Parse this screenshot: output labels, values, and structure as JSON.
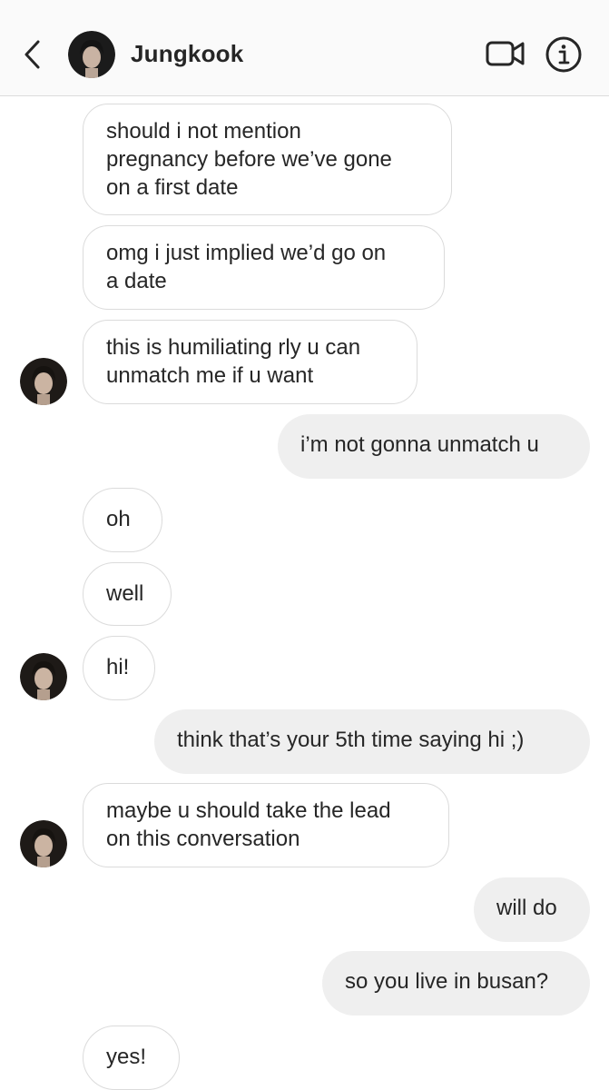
{
  "header": {
    "contact_name": "Jungkook",
    "icons": [
      "back-chevron-icon",
      "video-call-icon",
      "info-icon"
    ]
  },
  "messages": [
    {
      "side": "in",
      "text": "should i not mention\npregnancy before we’ve gone\non a first date"
    },
    {
      "side": "in",
      "text": "omg i just implied we’d go on\na date"
    },
    {
      "side": "in",
      "text": "this is humiliating rly u can\nunmatch me if u want"
    },
    {
      "side": "out",
      "text": "i’m not gonna unmatch u"
    },
    {
      "side": "in",
      "text": "oh"
    },
    {
      "side": "in",
      "text": "well"
    },
    {
      "side": "in",
      "text": "hi!"
    },
    {
      "side": "out",
      "text": "think that’s your 5th time saying hi ;)"
    },
    {
      "side": "in",
      "text": "maybe u should take the lead\non this conversation"
    },
    {
      "side": "out",
      "text": "will do"
    },
    {
      "side": "out",
      "text": "so you live in busan?"
    },
    {
      "side": "in",
      "text": "yes!"
    }
  ],
  "colors": {
    "incoming_bubble_bg": "#ffffff",
    "incoming_bubble_border": "#dbdbdb",
    "outgoing_bubble_bg": "#efefef",
    "header_bg": "#fafafa",
    "text": "#262626"
  }
}
